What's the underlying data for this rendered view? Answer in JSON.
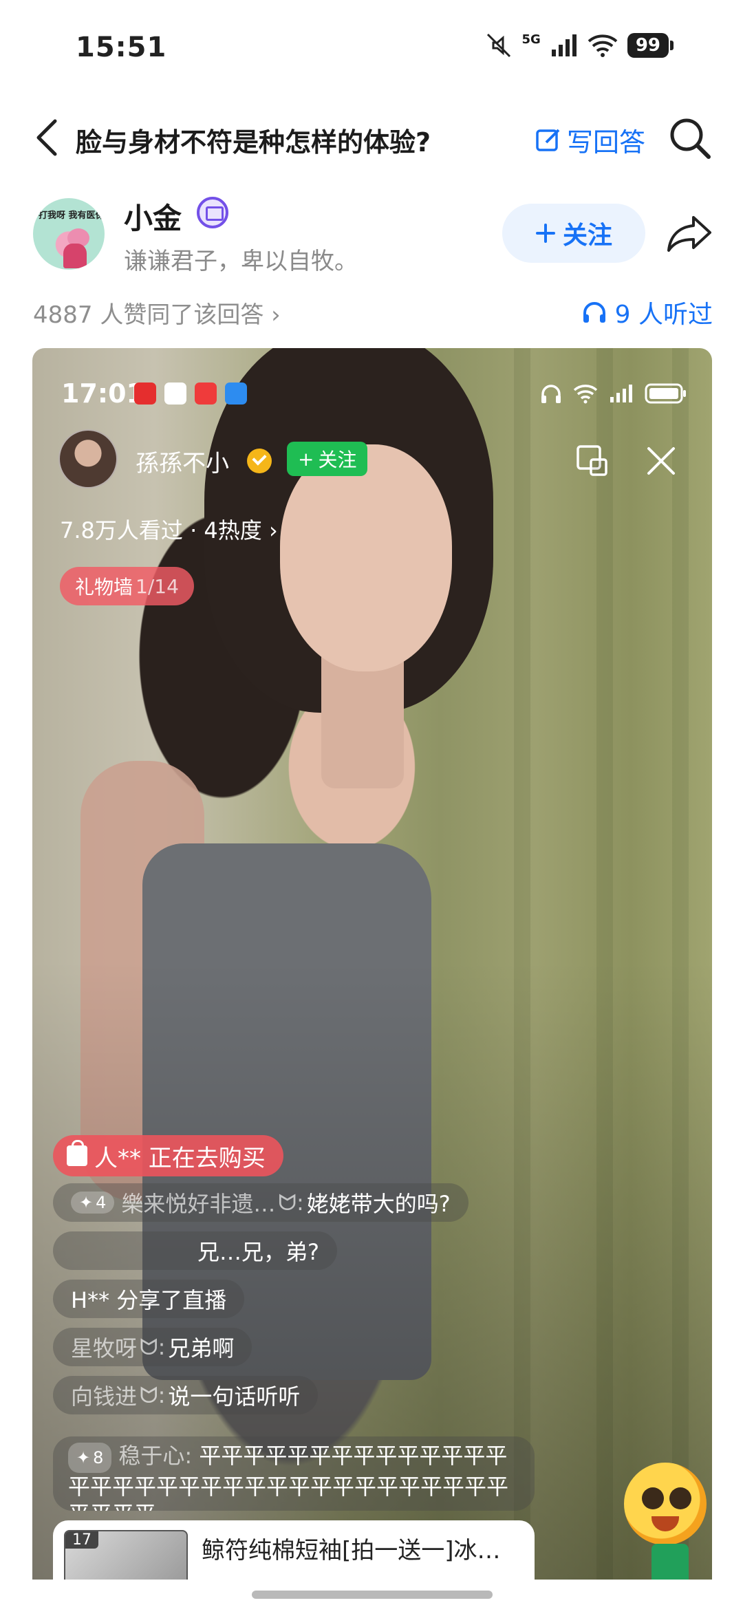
{
  "status_bar": {
    "time": "15:51",
    "network": "5G",
    "battery": "99",
    "icons": [
      "mute-icon",
      "signal-icon",
      "wifi-icon",
      "battery-icon"
    ]
  },
  "header": {
    "back_icon": "back-arrow-icon",
    "question_title": "脸与身材不符是种怎样的体验?",
    "write_answer_label": "写回答",
    "search_icon": "search-icon"
  },
  "author": {
    "name": "小金",
    "bio": "谦谦君子，卑以自牧。",
    "avatar_text": "打我呀 我有医保",
    "follow_label": "关注",
    "share_icon": "share-icon"
  },
  "stats": {
    "likes_text": "4887 人赞同了该回答",
    "listen_text": "9 人听过"
  },
  "video": {
    "status_time": "17:01",
    "host_name": "孫孫不小",
    "host_follow_label": "关注",
    "views_text": "7.8万人看过 · 4热度",
    "gift_wall_label": "礼物墙",
    "gift_wall_fraction": "1/14",
    "buying_text": "人** 正在去购买",
    "comments": [
      {
        "level": "4",
        "user": "樂来悦好非遗…",
        "text": "姥姥带大的吗?"
      },
      {
        "level": "",
        "user": "",
        "text": "兄…兄，弟?"
      },
      {
        "level": "",
        "user": "",
        "text": "H** 分享了直播"
      },
      {
        "level": "",
        "user": "星牧呀",
        "text": "兄弟啊"
      },
      {
        "level": "",
        "user": "向钱进",
        "text": "说一句话听听"
      }
    ],
    "long_comment": {
      "level": "8",
      "user": "稳于心:",
      "text": "平平平平平平平平平平平平平平平平平平平平平平平平平平平平平平平平平平平平平平"
    },
    "product_badge": "17",
    "product_title": "鲸符纯棉短袖[拍一送一]冰…"
  }
}
